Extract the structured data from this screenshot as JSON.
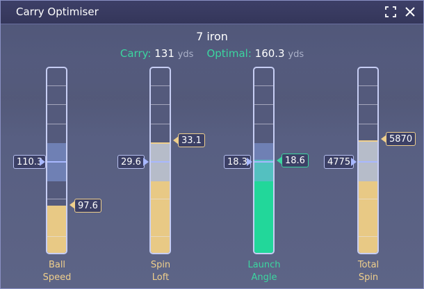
{
  "window": {
    "title": "Carry Optimiser"
  },
  "header": {
    "club": "7 iron",
    "carry_label": "Carry:",
    "carry_value": "131",
    "carry_unit": "yds",
    "optimal_label": "Optimal:",
    "optimal_value": "160.3",
    "optimal_unit": "yds"
  },
  "gauges": [
    {
      "label_line1": "Ball",
      "label_line2": "Speed",
      "current": "110.3",
      "optimal": "97.6"
    },
    {
      "label_line1": "Spin",
      "label_line2": "Loft",
      "current": "29.6",
      "optimal": "33.1"
    },
    {
      "label_line1": "Launch",
      "label_line2": "Angle",
      "current": "18.3",
      "optimal": "18.6"
    },
    {
      "label_line1": "Total",
      "label_line2": "Spin",
      "current": "4775",
      "optimal": "5870"
    }
  ],
  "colors": {
    "accent_green": "#3bd6a0",
    "optimal_gold": "#efcf8c",
    "current_blue": "#a8b8ff"
  },
  "icons": {
    "fullscreen": "fullscreen-icon",
    "close": "close-icon"
  }
}
